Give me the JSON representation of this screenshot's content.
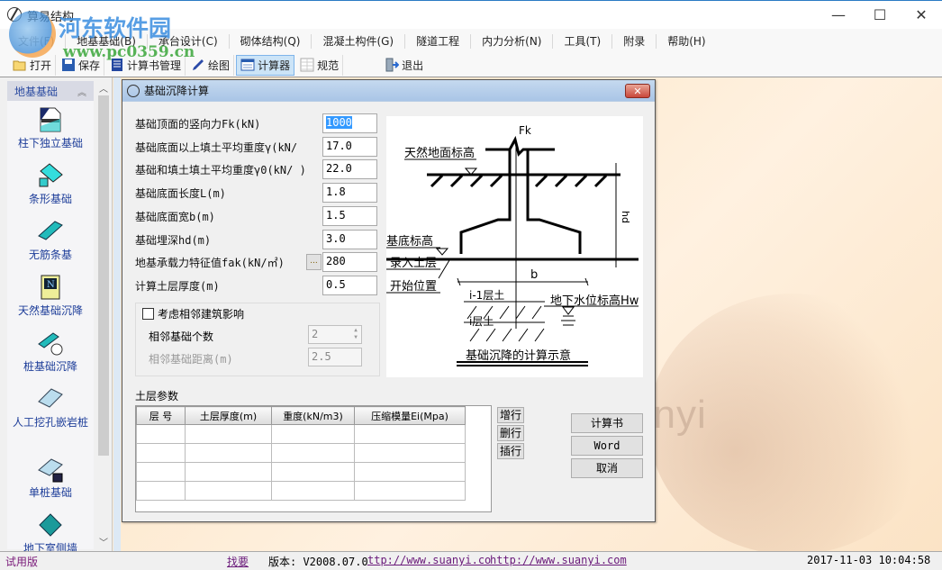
{
  "window": {
    "title": "算易结构",
    "controls": {
      "minimize": "—",
      "maximize": "☐",
      "close": "✕"
    }
  },
  "watermark": {
    "name": "河东软件园",
    "url": "www.pc0359.cn"
  },
  "menu": [
    "文件(F)",
    "地基基础(B)",
    "承台设计(C)",
    "砌体结构(Q)",
    "混凝土构件(G)",
    "隧道工程",
    "内力分析(N)",
    "工具(T)",
    "附录",
    "帮助(H)"
  ],
  "toolbar": [
    {
      "label": "打开",
      "icon": "folder-open-icon",
      "active": false
    },
    {
      "label": "保存",
      "icon": "floppy-disk-icon",
      "active": false
    },
    {
      "label": "计算书管理",
      "icon": "document-manager-icon",
      "active": false
    },
    {
      "label": "绘图",
      "icon": "pen-icon",
      "active": false
    },
    {
      "label": "计算器",
      "icon": "calculator-icon",
      "active": true
    },
    {
      "label": "规范",
      "icon": "grid-table-icon",
      "active": false
    },
    {
      "label": "退出",
      "icon": "exit-door-icon",
      "active": false
    }
  ],
  "sidebar": {
    "header": "地基基础",
    "items": [
      {
        "label": "柱下独立基础",
        "icon": "isolated-footing-icon"
      },
      {
        "label": "条形基础",
        "icon": "strip-footing-icon"
      },
      {
        "label": "无筋条基",
        "icon": "plain-strip-footing-icon"
      },
      {
        "label": "天然基础沉降",
        "icon": "natural-foundation-settlement-icon"
      },
      {
        "label": "桩基础沉降",
        "icon": "pile-settlement-icon"
      },
      {
        "label": "人工挖孔嵌岩桩",
        "icon": "bored-pile-icon"
      },
      {
        "label": "单桩基础",
        "icon": "single-pile-icon"
      },
      {
        "label": "地下室侧墙",
        "icon": "basement-wall-icon"
      }
    ]
  },
  "dialog": {
    "title": "基础沉降计算",
    "close": "✕",
    "fields": [
      {
        "label": "基础顶面的竖向力Fk(kN)",
        "value": "1000",
        "selected": true
      },
      {
        "label": "基础底面以上填土平均重度γ(kN/",
        "value": "17.0"
      },
      {
        "label": "基础和填土填土平均重度γ0(kN/   )",
        "value": "22.0"
      },
      {
        "label": "基础底面长度L(m)",
        "value": "1.8"
      },
      {
        "label": "基础底面宽b(m)",
        "value": "1.5"
      },
      {
        "label": "基础埋深hd(m)",
        "value": "3.0"
      },
      {
        "label": "地基承载力特征值fak(kN/㎡)",
        "value": "280",
        "has_browse": true
      },
      {
        "label": "计算土层厚度(m)",
        "value": "0.5"
      }
    ],
    "browse_label": "...",
    "adjacent": {
      "checkbox_label": "考虑相邻建筑影响",
      "checked": false,
      "count_label": "相邻基础个数",
      "count_value": "2",
      "distance_label": "相邻基础距离(m)",
      "distance_value": "2.5"
    },
    "diagram": {
      "force_label": "Fk",
      "ground_label": "天然地面标高",
      "base_label": "基底标高",
      "depth_label": "hd",
      "entry_label_1": "录入土层",
      "entry_label_2": "开始位置",
      "width_label": "b",
      "layer_prev": "i-1层土",
      "layer_i": "i层土",
      "water_label": "地下水位标高Hw",
      "caption": "基础沉降的计算示意"
    },
    "soil_section_title": "土层参数",
    "soil_table": {
      "columns": [
        "层 号",
        "土层厚度(m)",
        "重度(kN/m3)",
        "压缩模量Ei(Mpa)"
      ],
      "rows": [
        [
          "",
          "",
          "",
          ""
        ],
        [
          "",
          "",
          "",
          ""
        ],
        [
          "",
          "",
          "",
          ""
        ],
        [
          "",
          "",
          "",
          ""
        ]
      ]
    },
    "row_buttons": [
      "增行",
      "删行",
      "插行"
    ],
    "action_buttons": [
      "计算书",
      "Word",
      "取消"
    ]
  },
  "background_text": "anyi",
  "status": {
    "edition": "试用版",
    "link1": "找要",
    "version": "版本: V2008.07.0",
    "url1": "ttp://www.suanyi.co",
    "url2": "http://www.suanyi.com",
    "datetime": "2017-11-03 10:04:58"
  }
}
